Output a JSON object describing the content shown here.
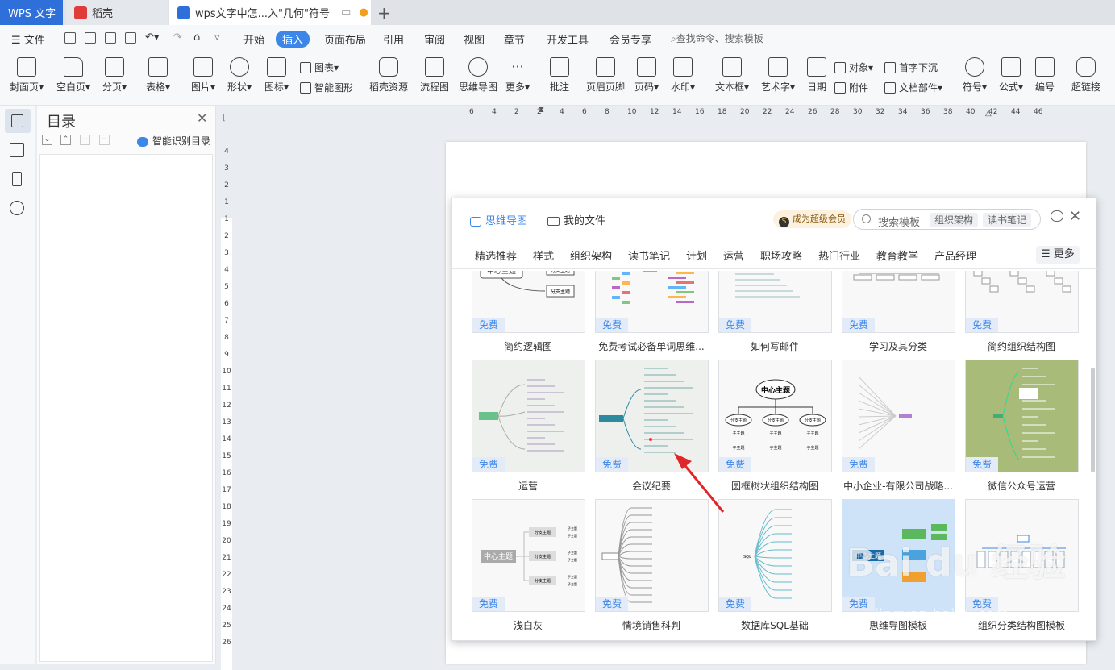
{
  "tabs": {
    "wps": "WPS 文字",
    "daoke": "稻壳",
    "doc": "wps文字中怎...入\"几何\"符号"
  },
  "menu": {
    "file": "文件",
    "tabs": [
      "开始",
      "插入",
      "页面布局",
      "引用",
      "审阅",
      "视图",
      "章节",
      "开发工具",
      "会员专享"
    ],
    "active_tab": "插入",
    "search_placeholder": "查找命令、搜索模板"
  },
  "ribbon": {
    "big": [
      "封面页",
      "空白页",
      "分页",
      "表格",
      "图片",
      "形状",
      "图标",
      "稻壳资源",
      "流程图",
      "思维导图",
      "更多",
      "批注",
      "页眉页脚",
      "页码",
      "水印",
      "文本框",
      "艺术字",
      "日期",
      "符号",
      "公式",
      "编号",
      "超链接"
    ],
    "small": [
      "图表",
      "智能图形",
      "对象",
      "附件",
      "首字下沉",
      "文档部件"
    ]
  },
  "toc": {
    "title": "目录",
    "smart": "智能识别目录"
  },
  "ruler": {
    "h": [
      "6",
      "4",
      "2",
      "2",
      "4",
      "6",
      "8",
      "10",
      "12",
      "14",
      "16",
      "18",
      "20",
      "22",
      "24",
      "26",
      "28",
      "30",
      "32",
      "34",
      "36",
      "38",
      "40",
      "42",
      "44",
      "46"
    ],
    "v": [
      "4",
      "3",
      "2",
      "1",
      "1",
      "2",
      "3",
      "4",
      "5",
      "6",
      "7",
      "8",
      "9",
      "10",
      "11",
      "12",
      "13",
      "14",
      "15",
      "16",
      "17",
      "18",
      "19",
      "20",
      "21",
      "22",
      "23",
      "24",
      "25",
      "26"
    ]
  },
  "dialog": {
    "mindmap": "思维导图",
    "myfiles": "我的文件",
    "vip": "成为超级会员",
    "vip_badge": "S",
    "search_placeholder": "搜索模板",
    "chips": [
      "组织架构",
      "读书笔记"
    ],
    "categories": [
      "精选推荐",
      "样式",
      "组织架构",
      "读书笔记",
      "计划",
      "运营",
      "职场攻略",
      "热门行业",
      "教育教学",
      "产品经理"
    ],
    "more": "更多",
    "free": "免费",
    "templates": [
      "简约逻辑图",
      "免费考试必备单词思维...",
      "如何写邮件",
      "学习及其分类",
      "简约组织结构图",
      "运营",
      "会议纪要",
      "圆框树状组织结构图",
      "中小企业-有限公司战略...",
      "微信公众号运营",
      "浅白灰",
      "情境销售科判",
      "数据库SQL基础",
      "思维导图模板",
      "组织分类结构图模板"
    ],
    "thumb_texts": {
      "center": "中心主题",
      "branch": "分支主题",
      "sub": "子主题"
    }
  },
  "watermark": {
    "main": "Bai du 经验",
    "sub": "jingyan.baidu.com"
  },
  "colors": {
    "accent": "#3b86e8",
    "wps_tab": "#2e6fd9",
    "arrow": "#e0262a",
    "free_bg": "#e2ebf7"
  }
}
